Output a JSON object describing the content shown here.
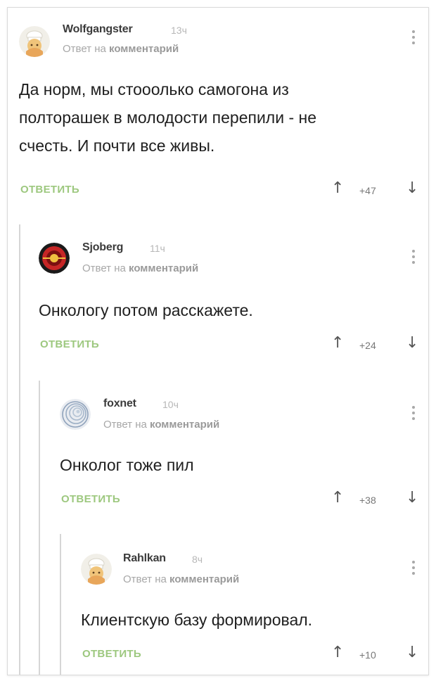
{
  "comments": [
    {
      "author": "Wolfgangster",
      "time": "13ч",
      "reply_prefix": "Ответ на",
      "reply_target": "комментарий",
      "text_lines": [
        "Да норм, мы стооолько самогона из",
        "полторашек в молодости перепили - не",
        "счесть. И почти все живы."
      ],
      "reply_label": "ОТВЕТИТЬ",
      "rating": "+47",
      "avatar_icon": "pikabu-chef-avatar-icon"
    },
    {
      "author": "Sjoberg",
      "time": "11ч",
      "reply_prefix": "Ответ на",
      "reply_target": "комментарий",
      "text_lines": [
        "Онкологу потом расскажете."
      ],
      "reply_label": "ОТВЕТИТЬ",
      "rating": "+24",
      "avatar_icon": "red-emblem-avatar-icon"
    },
    {
      "author": "foxnet",
      "time": "10ч",
      "reply_prefix": "Ответ на",
      "reply_target": "комментарий",
      "text_lines": [
        "Онколог тоже пил"
      ],
      "reply_label": "ОТВЕТИТЬ",
      "rating": "+38",
      "avatar_icon": "spiral-avatar-icon"
    },
    {
      "author": "Rahlkan",
      "time": "8ч",
      "reply_prefix": "Ответ на",
      "reply_target": "комментарий",
      "text_lines": [
        "Клиентскую базу формировал."
      ],
      "reply_label": "ОТВЕТИТЬ",
      "rating": "+10",
      "avatar_icon": "pikabu-chef-avatar-icon"
    }
  ],
  "colors": {
    "reply_button": "#9dc87f",
    "thread_line": "#d6d6d6",
    "muted_text": "#a7a7a7"
  }
}
